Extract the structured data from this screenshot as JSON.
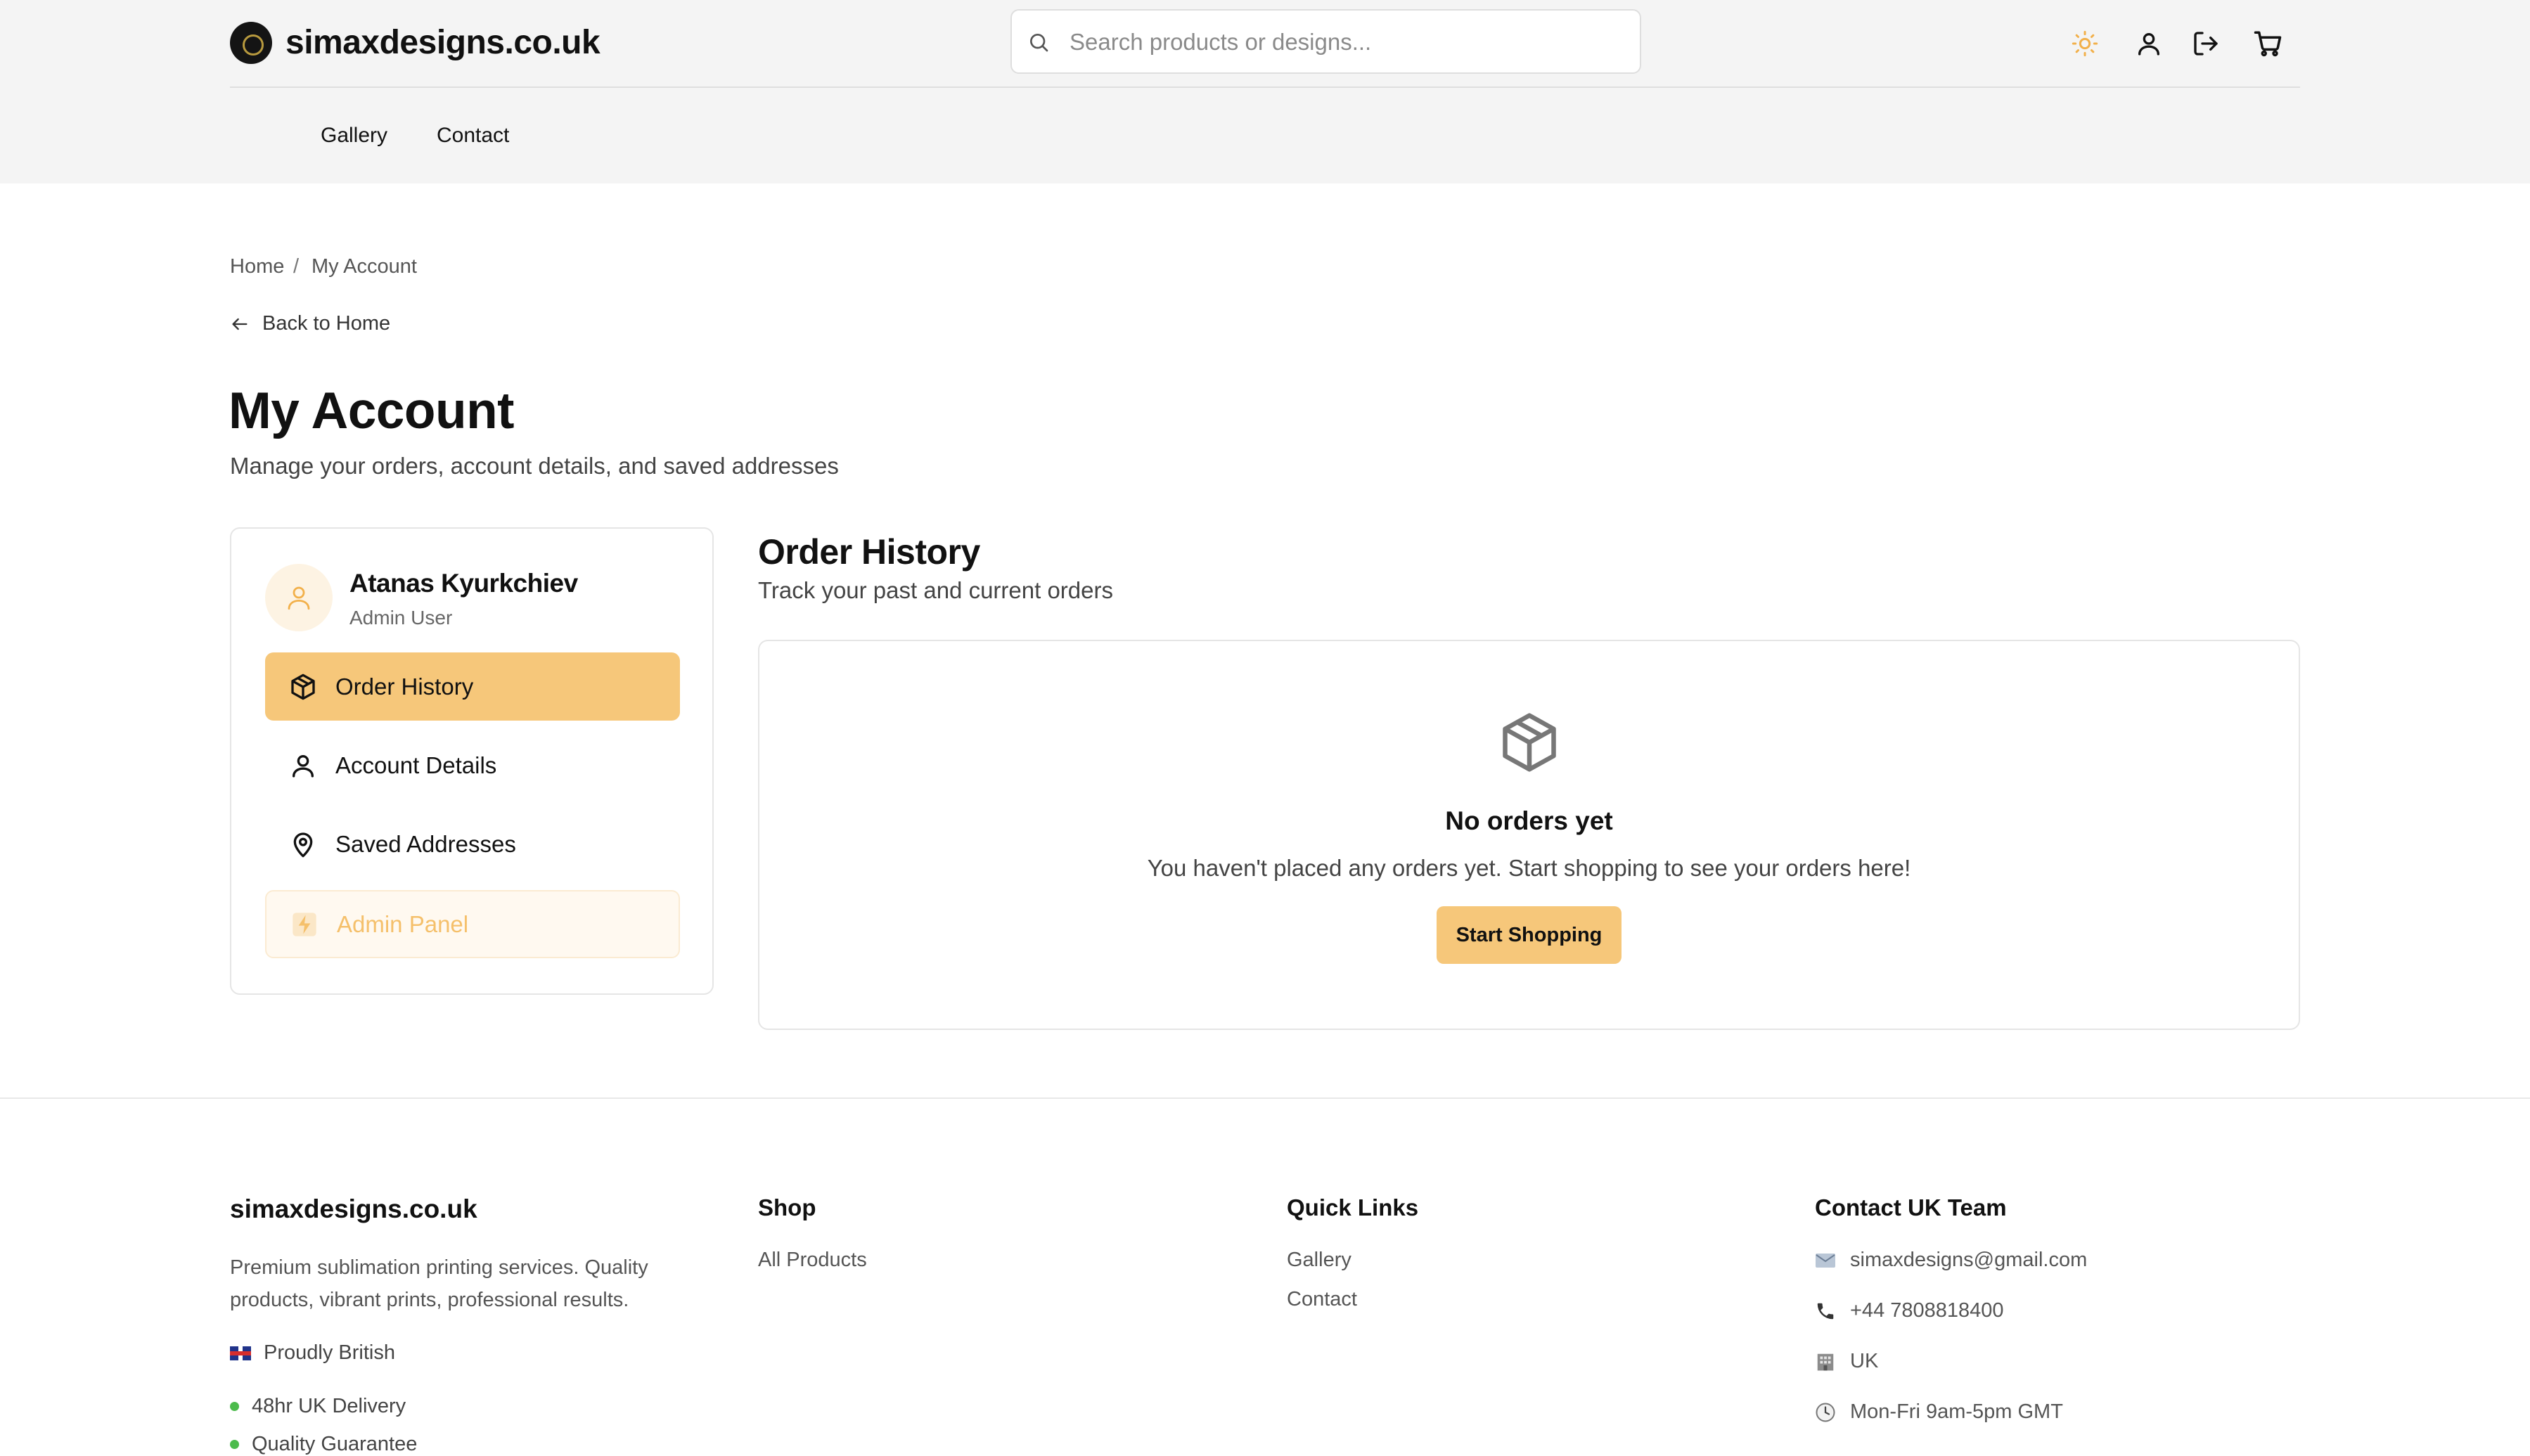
{
  "header": {
    "brand": "simaxdesigns.co.uk",
    "search_placeholder": "Search products or designs...",
    "icons": [
      "logo-icon",
      "search-icon",
      "sun-icon",
      "user-icon",
      "logout-icon",
      "cart-icon"
    ],
    "accent_color": "#f6c77a"
  },
  "nav": {
    "items": [
      {
        "label": "Gallery"
      },
      {
        "label": "Contact"
      }
    ]
  },
  "breadcrumb": {
    "home": "Home",
    "separator": "/",
    "current": "My Account"
  },
  "back_link": "Back to Home",
  "page": {
    "title": "My Account",
    "subtitle": "Manage your orders, account details, and saved addresses"
  },
  "sidebar": {
    "user_name": "Atanas Kyurkchiev",
    "user_role": "Admin User",
    "items": [
      {
        "label": "Order History",
        "icon": "package-icon",
        "active": true
      },
      {
        "label": "Account Details",
        "icon": "user-icon"
      },
      {
        "label": "Saved Addresses",
        "icon": "map-pin-icon"
      },
      {
        "label": "Admin Panel",
        "icon": "lightning-icon"
      }
    ]
  },
  "order_history": {
    "title": "Order History",
    "subtitle": "Track your past and current orders",
    "empty_title": "No orders yet",
    "empty_message": "You haven't placed any orders yet. Start shopping to see your orders here!",
    "button": "Start Shopping"
  },
  "footer": {
    "brand": "simaxdesigns.co.uk",
    "description": "Premium sublimation printing services. Quality products, vibrant prints, professional results.",
    "proudly_british": "Proudly British",
    "bullets": [
      "48hr UK Delivery",
      "Quality Guarantee"
    ],
    "shop": {
      "heading": "Shop",
      "links": [
        "All Products"
      ]
    },
    "quick_links": {
      "heading": "Quick Links",
      "links": [
        "Gallery",
        "Contact"
      ]
    },
    "contact": {
      "heading": "Contact UK Team",
      "email": "simaxdesigns@gmail.com",
      "phone": "+44 7808818400",
      "location": "UK",
      "hours": "Mon-Fri 9am-5pm GMT"
    }
  }
}
